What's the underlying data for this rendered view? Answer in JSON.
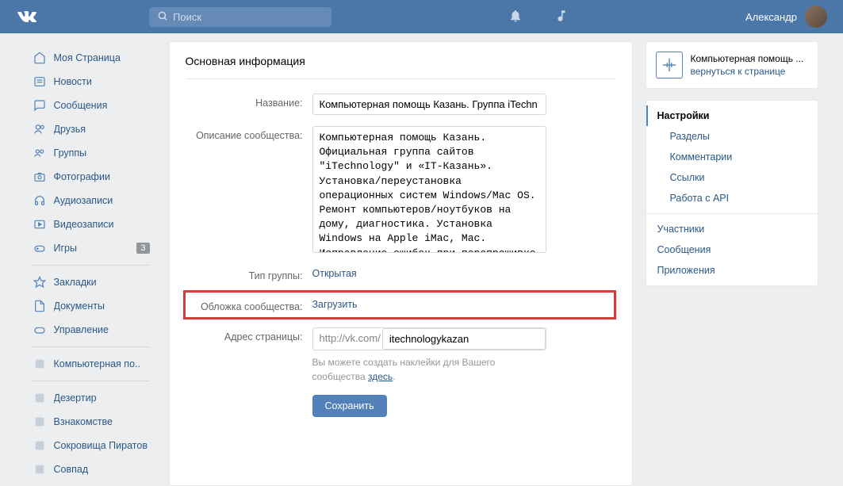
{
  "header": {
    "search_placeholder": "Поиск",
    "user_name": "Александр"
  },
  "left_nav": {
    "items_top": [
      {
        "icon": "home",
        "label": "Моя Страница"
      },
      {
        "icon": "news",
        "label": "Новости"
      },
      {
        "icon": "msg",
        "label": "Сообщения"
      },
      {
        "icon": "friends",
        "label": "Друзья"
      },
      {
        "icon": "groups",
        "label": "Группы"
      },
      {
        "icon": "photo",
        "label": "Фотографии"
      },
      {
        "icon": "audio",
        "label": "Аудиозаписи"
      },
      {
        "icon": "video",
        "label": "Видеозаписи"
      },
      {
        "icon": "games",
        "label": "Игры",
        "badge": "3"
      }
    ],
    "items_mid": [
      {
        "icon": "bookmark",
        "label": "Закладки"
      },
      {
        "icon": "doc",
        "label": "Документы"
      },
      {
        "icon": "gamepad",
        "label": "Управление"
      }
    ],
    "items_bot1": [
      {
        "icon": "blank",
        "label": "Компьютерная по.."
      }
    ],
    "items_bot2": [
      {
        "icon": "blank",
        "label": "Дезертир"
      },
      {
        "icon": "blank",
        "label": "Взнакомстве"
      },
      {
        "icon": "blank",
        "label": "Сокровища Пиратов"
      },
      {
        "icon": "blank",
        "label": "Совпад"
      }
    ]
  },
  "content": {
    "title": "Основная информация",
    "name_label": "Название:",
    "name_value": "Компьютерная помощь Казань. Группа iTechn",
    "desc_label": "Описание сообщества:",
    "desc_value": "Компьютерная помощь Казань. Официальная группа сайтов \"iTechnology\" и «IT-Казань».  Установка/переустановка операционных систем Windows/Mac OS. Ремонт компьютеров/ноутбуков на дому, диагностика. Установка Windows на Apple iMac, Mac. Исправление ошибок при перепрошивке iPhone, прошивка iPhone. Новости в области IT. Видео приколы и не только.",
    "type_label": "Тип группы:",
    "type_value": "Открытая",
    "cover_label": "Обложка сообщества:",
    "cover_value": "Загрузить",
    "url_label": "Адрес страницы:",
    "url_prefix": "http://vk.com/",
    "url_value": "itechnologykazan",
    "stickers_hint": "Вы можете создать наклейки для Вашего сообщества ",
    "stickers_link": "здесь",
    "save_btn": "Сохранить"
  },
  "right": {
    "community_name": "Компьютерная помощь ...",
    "back_link": "вернуться к странице",
    "settings": {
      "active": "Настройки",
      "subs": [
        "Разделы",
        "Комментарии",
        "Ссылки",
        "Работа с API"
      ],
      "items": [
        "Участники",
        "Сообщения",
        "Приложения"
      ]
    }
  }
}
